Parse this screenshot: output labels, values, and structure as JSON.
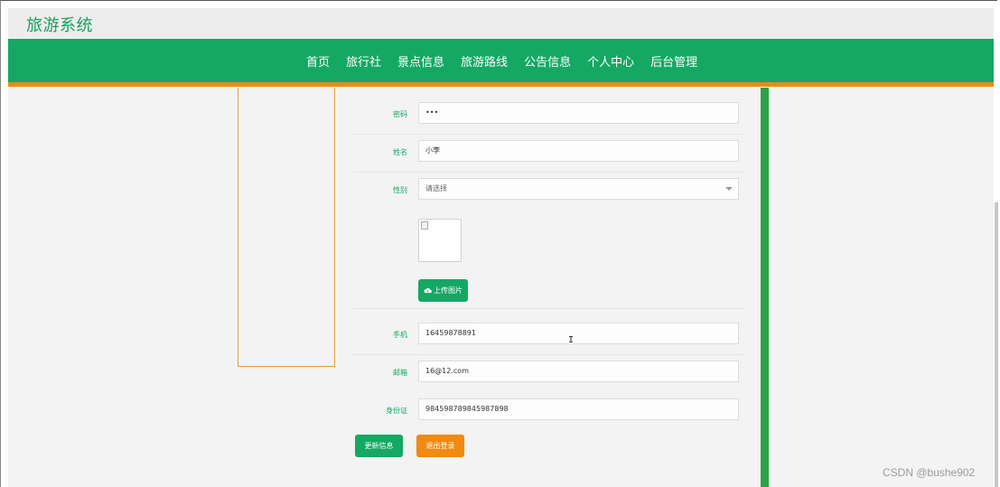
{
  "header": {
    "site_title": "旅游系统"
  },
  "nav": {
    "items": [
      {
        "label": "首页"
      },
      {
        "label": "旅行社"
      },
      {
        "label": "景点信息"
      },
      {
        "label": "旅游路线"
      },
      {
        "label": "公告信息"
      },
      {
        "label": "个人中心"
      },
      {
        "label": "后台管理"
      }
    ]
  },
  "form": {
    "password": {
      "label": "密码",
      "value": "•••"
    },
    "name": {
      "label": "姓名",
      "value": "小李"
    },
    "gender": {
      "label": "性别",
      "value": "请选择"
    },
    "upload_label": "上传图片",
    "phone": {
      "label": "手机",
      "value": "16459878891"
    },
    "email": {
      "label": "邮箱",
      "value": "16@12.com"
    },
    "id_card": {
      "label": "身份证",
      "value": "984598789845987898"
    },
    "update_label": "更新信息",
    "logout_label": "退出登录"
  },
  "watermark": "CSDN @bushe902",
  "colors": {
    "primary": "#14a863",
    "accent": "#ef8b16",
    "title": "#18a05e"
  }
}
